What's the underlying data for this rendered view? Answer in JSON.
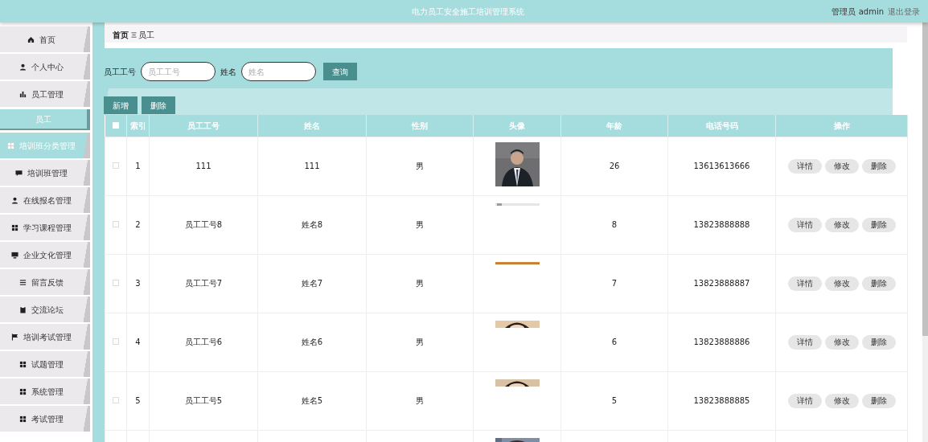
{
  "header": {
    "title": "电力员工安全施工培训管理系统",
    "user": "管理员 admin",
    "logout": "退出登录"
  },
  "sidebar": {
    "items": [
      {
        "label": "首页",
        "selected": false
      },
      {
        "label": "个人中心",
        "selected": false
      },
      {
        "label": "员工管理",
        "selected": false,
        "children": [
          {
            "label": "员工",
            "selected": true
          }
        ]
      },
      {
        "label": "培训班分类管理",
        "selected": false,
        "hovered": true
      },
      {
        "label": "培训班管理",
        "selected": false
      },
      {
        "label": "在线报名管理",
        "selected": false
      },
      {
        "label": "学习课程管理",
        "selected": false
      },
      {
        "label": "企业文化管理",
        "selected": false
      },
      {
        "label": "留言反馈",
        "selected": false
      },
      {
        "label": "交流论坛",
        "selected": false
      },
      {
        "label": "培训考试管理",
        "selected": false
      },
      {
        "label": "试题管理",
        "selected": false
      },
      {
        "label": "系统管理",
        "selected": false
      },
      {
        "label": "考试管理",
        "selected": false
      }
    ]
  },
  "breadcrumb": [
    "首页",
    "员工"
  ],
  "search": {
    "fields": [
      {
        "label": "员工工号",
        "placeholder": "员工工号"
      },
      {
        "label": "姓名",
        "placeholder": "姓名"
      }
    ],
    "button": "查询"
  },
  "actions": [
    "新增",
    "删除"
  ],
  "table": {
    "select_all": {
      "checked": false
    },
    "columns": [
      "索引",
      "员工工号",
      "姓名",
      "性别",
      "头像",
      "年龄",
      "电话号码",
      "操作"
    ],
    "rows": [
      {
        "checked": false,
        "index": "1",
        "employee_no": "111",
        "name": "111",
        "gender": "男",
        "avatar": {
          "kind": "picture"
        },
        "age": "26",
        "phone": "13613613666",
        "buttons": [
          "详情",
          "修改",
          "删除"
        ]
      },
      {
        "checked": false,
        "index": "2",
        "employee_no": "员工工号8",
        "name": "姓名8",
        "gender": "男",
        "avatar": {
          "kind": "picture"
        },
        "age": "8",
        "phone": "13823888888",
        "buttons": [
          "详情",
          "修改",
          "删除"
        ]
      },
      {
        "checked": false,
        "index": "3",
        "employee_no": "员工工号7",
        "name": "姓名7",
        "gender": "男",
        "avatar": {
          "kind": "picture"
        },
        "age": "7",
        "phone": "13823888887",
        "buttons": [
          "详情",
          "修改",
          "删除"
        ]
      },
      {
        "checked": false,
        "index": "4",
        "employee_no": "员工工号6",
        "name": "姓名6",
        "gender": "男",
        "avatar": {
          "kind": "picture"
        },
        "age": "6",
        "phone": "13823888886",
        "buttons": [
          "详情",
          "修改",
          "删除"
        ]
      },
      {
        "checked": false,
        "index": "5",
        "employee_no": "员工工号5",
        "name": "姓名5",
        "gender": "男",
        "avatar": {
          "kind": "picture"
        },
        "age": "5",
        "phone": "13823888885",
        "buttons": [
          "详情",
          "修改",
          "删除"
        ]
      },
      {
        "avatar": {
          "kind": "picture"
        }
      }
    ]
  }
}
